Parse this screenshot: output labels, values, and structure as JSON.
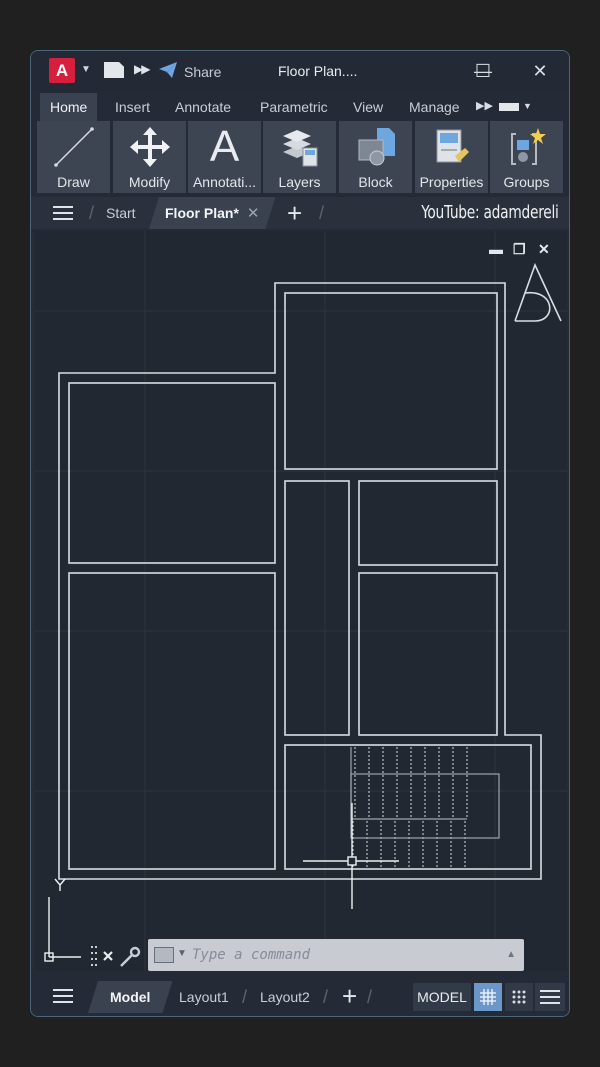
{
  "titlebar": {
    "app_logo_letter": "A",
    "share_label": "Share",
    "window_title": "Floor Plan....",
    "minimize_glyph": "—",
    "maximize_glyph": "☐",
    "close_glyph": "✕"
  },
  "ribbon": {
    "tabs": [
      {
        "label": "Home",
        "active": true
      },
      {
        "label": "Insert",
        "active": false
      },
      {
        "label": "Annotate",
        "active": false
      },
      {
        "label": "Parametric",
        "active": false
      },
      {
        "label": "View",
        "active": false
      },
      {
        "label": "Manage",
        "active": false
      }
    ],
    "overflow_glyph": "▶▶",
    "panels": [
      {
        "label": "Draw",
        "icon": "line-icon"
      },
      {
        "label": "Modify",
        "icon": "move-arrows-icon"
      },
      {
        "label": "Annotati...",
        "icon": "text-a-icon"
      },
      {
        "label": "Layers",
        "icon": "layers-icon"
      },
      {
        "label": "Block",
        "icon": "block-icon"
      },
      {
        "label": "Properties",
        "icon": "properties-icon"
      },
      {
        "label": "Groups",
        "icon": "groups-icon"
      }
    ]
  },
  "doc_tabs": {
    "tabs": [
      {
        "label": "Start",
        "active": false
      },
      {
        "label": "Floor Plan*",
        "active": true
      }
    ],
    "close_glyph": "✕",
    "add_glyph": "+",
    "watermark": "YouTube: adamdereli"
  },
  "viewport": {
    "controls": {
      "minimize": "▬",
      "restore": "❐",
      "close": "✕"
    },
    "ucs_label": "Y"
  },
  "command_line": {
    "placeholder": "Type a command",
    "close_glyph": "✕"
  },
  "statusbar": {
    "tabs": [
      {
        "label": "Model",
        "active": true
      },
      {
        "label": "Layout1",
        "active": false
      },
      {
        "label": "Layout2",
        "active": false
      }
    ],
    "add_glyph": "+",
    "model_label": "MODEL",
    "grid_on": true
  },
  "colors": {
    "brand_red": "#d61f3c",
    "accent_blue": "#6c97c9",
    "drawing_lines": "#d9dde3"
  }
}
